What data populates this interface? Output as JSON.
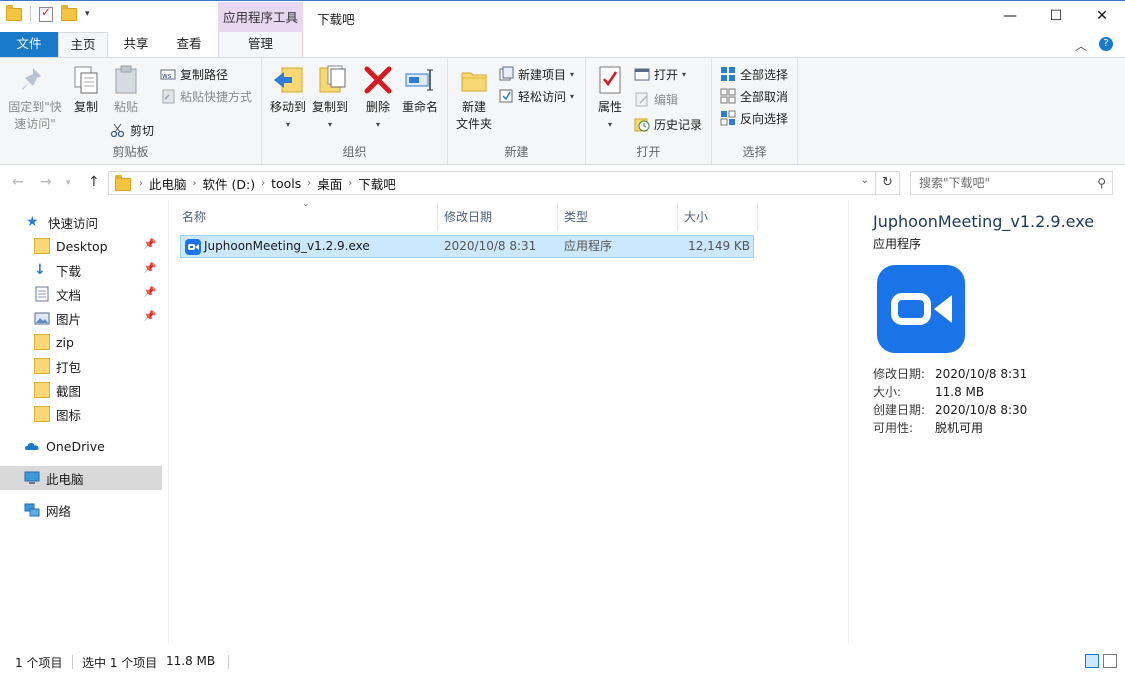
{
  "window": {
    "title": "下载吧",
    "context_tab_header": "应用程序工具",
    "controls": {
      "minimize": "—",
      "maximize": "☐",
      "close": "✕"
    }
  },
  "tabs": {
    "file": "文件",
    "home": "主页",
    "share": "共享",
    "view": "查看",
    "manage": "管理"
  },
  "ribbon": {
    "clipboard": {
      "label": "剪贴板",
      "pin_line1": "固定到\"快",
      "pin_line2": "速访问\"",
      "copy": "复制",
      "paste": "粘贴",
      "copy_path": "复制路径",
      "paste_shortcut": "粘贴快捷方式",
      "cut": "剪切"
    },
    "organize": {
      "label": "组织",
      "move_to": "移动到",
      "copy_to": "复制到",
      "delete": "删除",
      "rename": "重命名"
    },
    "new": {
      "label": "新建",
      "new_folder_line1": "新建",
      "new_folder_line2": "文件夹",
      "new_item": "新建项目",
      "easy_access": "轻松访问"
    },
    "open": {
      "label": "打开",
      "properties": "属性",
      "open": "打开",
      "edit": "编辑",
      "history": "历史记录"
    },
    "select": {
      "label": "选择",
      "select_all": "全部选择",
      "select_none": "全部取消",
      "invert": "反向选择"
    }
  },
  "address": {
    "crumbs": [
      "此电脑",
      "软件 (D:)",
      "tools",
      "桌面",
      "下载吧"
    ],
    "search_placeholder": "搜索\"下载吧\""
  },
  "sidebar": {
    "quick_access": "快速访问",
    "items": [
      {
        "label": "Desktop",
        "pinned": true
      },
      {
        "label": "下载",
        "pinned": true
      },
      {
        "label": "文档",
        "pinned": true
      },
      {
        "label": "图片",
        "pinned": true
      },
      {
        "label": "zip",
        "pinned": false
      },
      {
        "label": "打包",
        "pinned": false
      },
      {
        "label": "截图",
        "pinned": false
      },
      {
        "label": "图标",
        "pinned": false
      }
    ],
    "onedrive": "OneDrive",
    "this_pc": "此电脑",
    "network": "网络"
  },
  "columns": {
    "name": "名称",
    "modified": "修改日期",
    "type": "类型",
    "size": "大小"
  },
  "files": [
    {
      "name": "JuphoonMeeting_v1.2.9.exe",
      "modified": "2020/10/8 8:31",
      "type": "应用程序",
      "size": "12,149 KB"
    }
  ],
  "preview": {
    "title": "JuphoonMeeting_v1.2.9.exe",
    "type": "应用程序",
    "props": [
      {
        "k": "修改日期:",
        "v": "2020/10/8 8:31"
      },
      {
        "k": "大小:",
        "v": "11.8 MB"
      },
      {
        "k": "创建日期:",
        "v": "2020/10/8 8:30"
      },
      {
        "k": "可用性:",
        "v": "脱机可用"
      }
    ]
  },
  "status": {
    "count": "1 个项目",
    "selected": "选中 1 个项目",
    "selected_size": "11.8 MB"
  },
  "colors": {
    "accent": "#1979ca",
    "selection": "#cce8ff",
    "app_icon": "#1a74e8"
  }
}
